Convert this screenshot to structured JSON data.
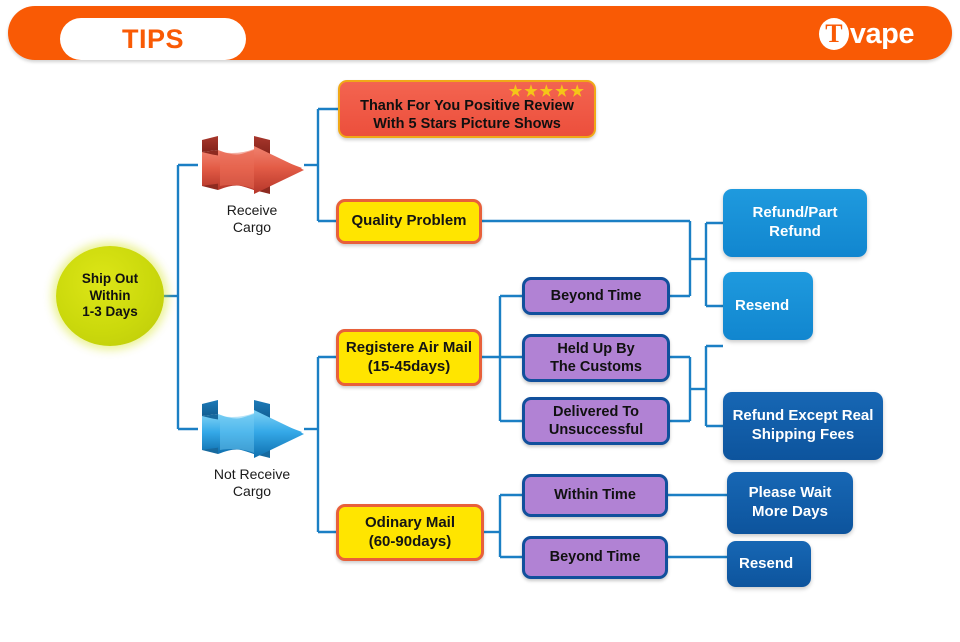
{
  "header": {
    "pill_label": "TIPS",
    "brand_mark": "T",
    "brand_text": "vape",
    "bar_color": "#f95a05",
    "pill_text_color": "#f95a05"
  },
  "flowchart": {
    "start": {
      "label": "Ship Out\nWithin\n1-3 Days",
      "color": "#cbd90c"
    },
    "branches": [
      {
        "name": "receive-cargo",
        "caption": "Receive\nCargo",
        "arrow_icon": "right-arrow-icon",
        "arrow_color": "#e0543f"
      },
      {
        "name": "not-receive-cargo",
        "caption": "Not Receive\nCargo",
        "arrow_icon": "right-arrow-icon",
        "arrow_color": "#2ba3e3"
      }
    ],
    "nodes": {
      "review": {
        "label": "Thank For You Positive Review\nWith 5 Stars Picture Shows",
        "stars": "★★★★★",
        "star_count": 5,
        "bg": "#ec4f3c",
        "border": "#f0a818"
      },
      "quality_problem": {
        "label": "Quality Problem",
        "bg": "#ffe500",
        "border": "#e8603a"
      },
      "air_mail": {
        "label": "Registere Air Mail\n(15-45days)",
        "bg": "#ffe500",
        "border": "#e8603a"
      },
      "ordinary_mail": {
        "label": "Odinary Mail\n(60-90days)",
        "bg": "#ffe500",
        "border": "#e8603a"
      },
      "beyond_time_air": {
        "label": "Beyond Time",
        "bg": "#b182d4",
        "border": "#11509c"
      },
      "held_up_customs": {
        "label": "Held Up By\nThe Customs",
        "bg": "#b182d4",
        "border": "#11509c"
      },
      "delivered_unsuccessful": {
        "label": "Delivered To\nUnsuccessful",
        "bg": "#b182d4",
        "border": "#11509c"
      },
      "within_time": {
        "label": "Within Time",
        "bg": "#b182d4",
        "border": "#11509c"
      },
      "beyond_time_ordinary": {
        "label": "Beyond Time",
        "bg": "#b182d4",
        "border": "#11509c"
      },
      "refund_part_refund": {
        "label": "Refund/Part\nRefund",
        "bg": "#1186cf"
      },
      "resend_air": {
        "label": "Resend",
        "bg": "#1186cf"
      },
      "refund_except_shipping": {
        "label": "Refund Except Real\nShipping Fees",
        "bg": "#0d549d"
      },
      "please_wait": {
        "label": "Please Wait\nMore Days",
        "bg": "#0d549d"
      },
      "resend_ordinary": {
        "label": "Resend",
        "bg": "#0d549d"
      }
    },
    "connector_color": "#1b7fc4"
  }
}
